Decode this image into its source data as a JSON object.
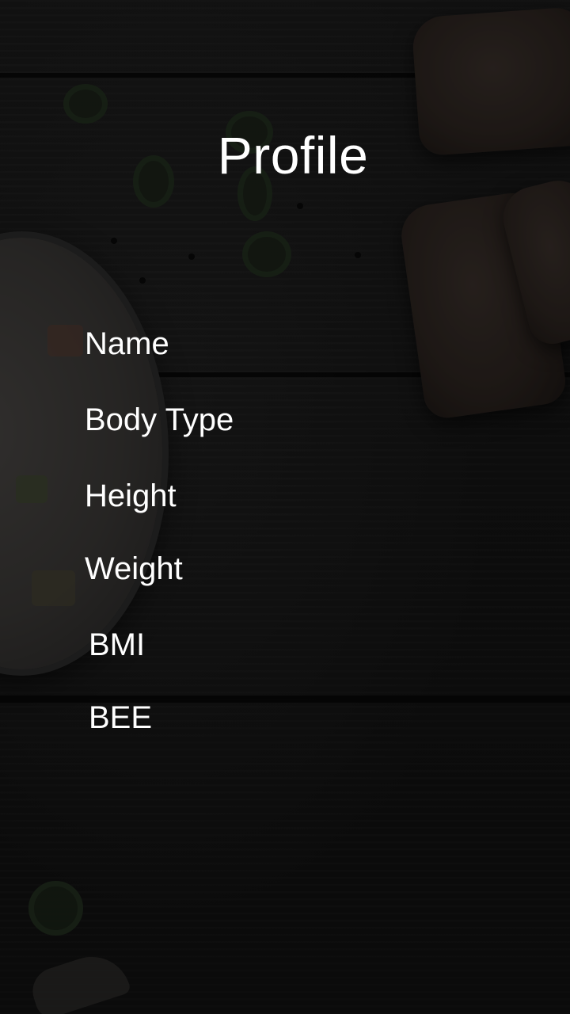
{
  "header": {
    "title": "Profile"
  },
  "profile_fields": [
    {
      "label": "Name"
    },
    {
      "label": "Body Type"
    },
    {
      "label": "Height"
    },
    {
      "label": "Weight"
    },
    {
      "label": "BMI"
    },
    {
      "label": "BEE"
    }
  ],
  "colors": {
    "text": "#ffffff",
    "background": "#141414"
  }
}
